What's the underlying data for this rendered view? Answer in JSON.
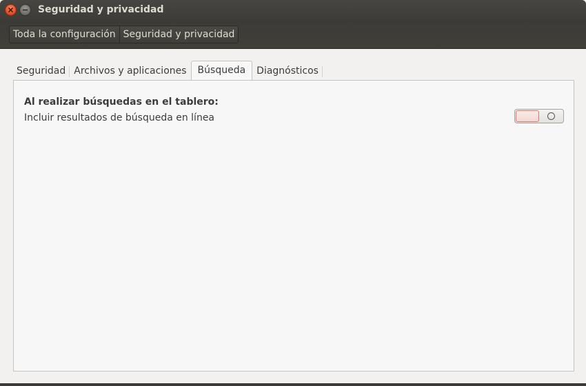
{
  "window": {
    "title": "Seguridad y privacidad",
    "controls": [
      "close-icon",
      "minimize-icon"
    ]
  },
  "toolbar": {
    "breadcrumb": [
      {
        "label": "Toda la configuración"
      },
      {
        "label": "Seguridad y privacidad"
      }
    ]
  },
  "tabs": [
    {
      "label": "Seguridad",
      "active": false
    },
    {
      "label": "Archivos y aplicaciones",
      "active": false
    },
    {
      "label": "Búsqueda",
      "active": true
    },
    {
      "label": "Diagnósticos",
      "active": false
    }
  ],
  "search_tab": {
    "heading": "Al realizar búsquedas en el tablero:",
    "online_results": {
      "label": "Incluir resultados de búsqueda en línea",
      "enabled": false
    }
  },
  "colors": {
    "titlebar": "#3c3b37",
    "close_button": "#e2481d",
    "switch_highlight": "#d87a68"
  }
}
